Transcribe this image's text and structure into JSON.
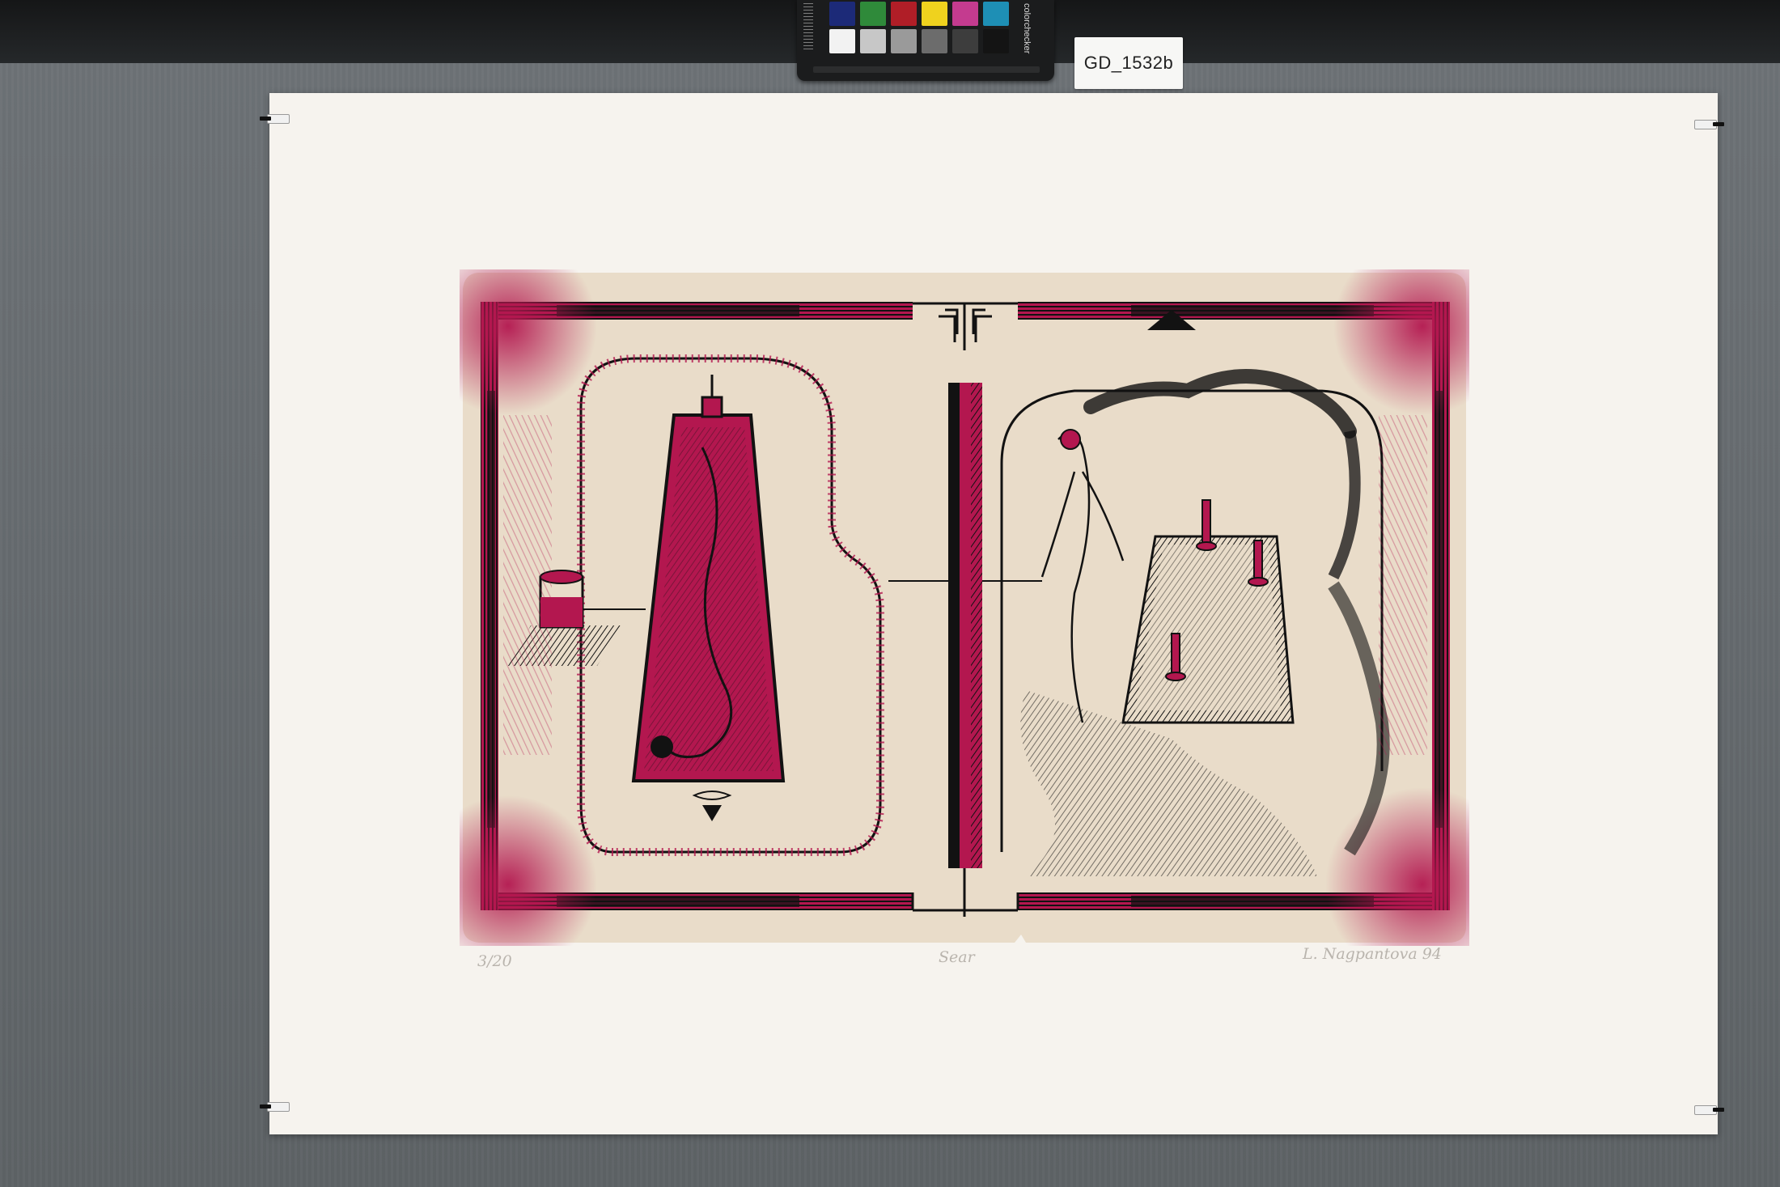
{
  "label": {
    "catalog_id": "GD_1532b"
  },
  "colorchecker": {
    "brand_text": "colorchecker",
    "top_row_colors": [
      "#1c2a78",
      "#2f8a3a",
      "#b01e27",
      "#efd21e",
      "#c43b8f",
      "#1e8fb5"
    ],
    "bottom_row_colors": [
      "#f2f2f2",
      "#c7c7c7",
      "#9a9a9a",
      "#6c6c6c",
      "#3d3d3d",
      "#141414"
    ]
  },
  "artwork": {
    "colors": {
      "paper": "#e9dcc9",
      "magenta": "#b3174f",
      "ink": "#121212",
      "sheet": "#f6f3ee"
    }
  },
  "pencil_inscriptions": {
    "edition": "3/20",
    "title": "Sear",
    "signature": "L. Nagpantova 94"
  }
}
